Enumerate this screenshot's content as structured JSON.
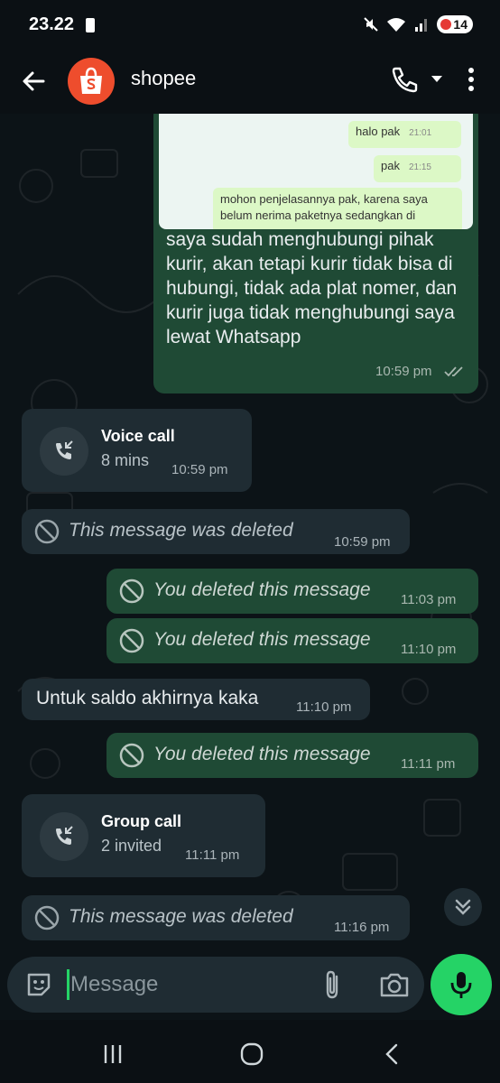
{
  "status_bar": {
    "time": "23.22",
    "battery": "14"
  },
  "header": {
    "contact_name": "shopee"
  },
  "image_preview": {
    "bubbles": [
      {
        "text": "halo pak",
        "time": "21:01"
      },
      {
        "text": "pak",
        "time": "21:15"
      },
      {
        "text": "mohon penjelasannya pak, karena saya belum nerima paketnya sedangkan di"
      }
    ]
  },
  "messages": [
    {
      "text": "saya sudah menghubungi pihak kurir, akan tetapi kurir tidak bisa di hubungi, tidak ada plat nomer, dan kurir juga tidak menghubungi saya lewat Whatsapp",
      "time": "10:59 pm"
    },
    {
      "call_title": "Voice call",
      "call_sub": "8 mins",
      "time": "10:59 pm"
    },
    {
      "text": "This message was deleted",
      "time": "10:59 pm"
    },
    {
      "text": "You deleted this message",
      "time": "11:03 pm"
    },
    {
      "text": "You deleted this message",
      "time": "11:10 pm"
    },
    {
      "text": "Untuk saldo akhirnya kaka",
      "time": "11:10 pm"
    },
    {
      "text": "You deleted this message",
      "time": "11:11 pm"
    },
    {
      "call_title": "Group call",
      "call_sub": "2 invited",
      "time": "11:11 pm"
    },
    {
      "text": "This message was deleted",
      "time": "11:16 pm"
    }
  ],
  "input": {
    "placeholder": "Message"
  },
  "colors": {
    "outgoing": "#1f4a35",
    "incoming": "#1f2c33",
    "accent": "#25d366",
    "avatar": "#ee4d2d"
  }
}
